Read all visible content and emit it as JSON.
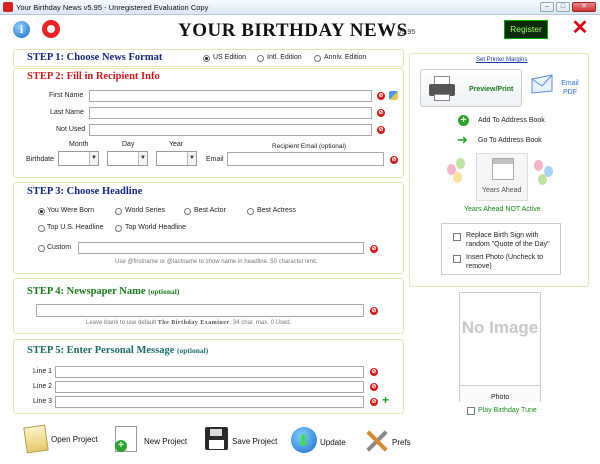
{
  "window": {
    "title": "Your Birthday News v5.95 - Unregistered Evaluation Copy",
    "controls": [
      "–",
      "□",
      "✕"
    ]
  },
  "header": {
    "logo": "YOUR BIRTHDAY NEWS",
    "version": "v5.95",
    "register_label": "Register"
  },
  "step1": {
    "title": "STEP 1: Choose News Format",
    "options": [
      {
        "label": "US Edition",
        "selected": true
      },
      {
        "label": "Intl. Edition",
        "selected": false
      },
      {
        "label": "Anniv. Edition",
        "selected": false
      }
    ]
  },
  "step2": {
    "title": "STEP 2: Fill in Recipient Info",
    "first_name_label": "First Name",
    "last_name_label": "Last Name",
    "not_used_label": "Not Used",
    "birthdate_label": "Birthdate",
    "month_label": "Month",
    "day_label": "Day",
    "year_label": "Year",
    "email_label": "Email",
    "recipient_email_label": "Recipient Email (optional)",
    "first_name": "",
    "last_name": "",
    "not_used": "",
    "email": ""
  },
  "step3": {
    "title": "STEP 3: Choose Headline",
    "options": [
      {
        "label": "You Were Born",
        "selected": true
      },
      {
        "label": "World Series",
        "selected": false
      },
      {
        "label": "Best Actor",
        "selected": false
      },
      {
        "label": "Best Actress",
        "selected": false
      },
      {
        "label": "Top U.S. Headline",
        "selected": false
      },
      {
        "label": "Top World Headline",
        "selected": false
      }
    ],
    "custom_label": "Custom",
    "custom_value": "",
    "hint": "Use @firstname or @lastname to show name in headline. 50 character limit."
  },
  "step4": {
    "title": "STEP 4: Newspaper Name",
    "optional": "(optional)",
    "value": "",
    "hint_prefix": "Leave blank to use default",
    "hint_name": "The Birthday Examiner",
    "hint_suffix": ". 34 char. max. 0 Used."
  },
  "step5": {
    "title": "STEP 5: Enter Personal Message",
    "optional": "(optional)",
    "lines": [
      {
        "label": "Line 1",
        "value": ""
      },
      {
        "label": "Line 2",
        "value": ""
      },
      {
        "label": "Line 3",
        "value": ""
      }
    ]
  },
  "right_panel": {
    "set_printer_margins": "Set Printer Margins",
    "preview_print": "Preview/Print",
    "email_pdf": "Email PDF",
    "add_to_address_book": "Add To Address Book",
    "go_to_address_book": "Go To Address Book",
    "years_ahead": "Years Ahead",
    "years_ahead_status": "Years Ahead NOT Active",
    "replace_birth_sign": "Replace Birth Sign with random \"Quote of the Day\"",
    "insert_photo": "Insert Photo (Uncheck to remove)",
    "no_image": "No Image",
    "photo_label": "Photo",
    "play_birthday_tune": "Play Birthday Tune"
  },
  "toolbar": {
    "open_project": "Open Project",
    "new_project": "New Project",
    "save_project": "Save Project",
    "update": "Update",
    "prefs": "Prefs"
  },
  "colors": {
    "step_blue": "#13277a",
    "step_red": "#cc1b1b",
    "step_teal": "#1b6b6b",
    "step_green": "#1b7a1b",
    "register_bg": "#0b2a0b"
  }
}
